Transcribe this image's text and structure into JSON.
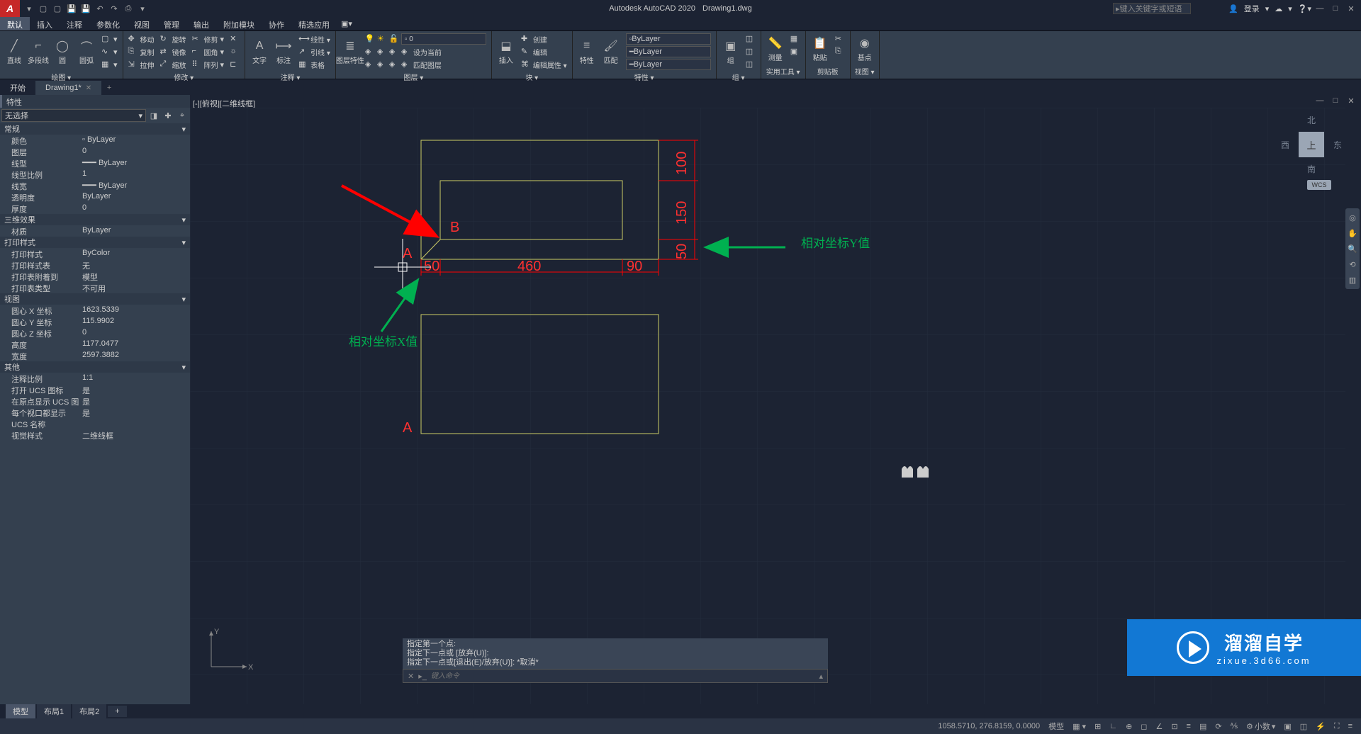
{
  "title": {
    "app": "Autodesk AutoCAD 2020",
    "doc": "Drawing1.dwg"
  },
  "search": {
    "placeholder": "键入关键字或短语"
  },
  "user": {
    "login": "登录"
  },
  "menu": {
    "tabs": [
      "默认",
      "插入",
      "注释",
      "参数化",
      "视图",
      "管理",
      "输出",
      "附加模块",
      "协作",
      "精选应用"
    ]
  },
  "ribbon": {
    "draw": {
      "label": "绘图 ▾",
      "line": "直线",
      "polyline": "多段线",
      "circle": "圆",
      "arc": "圆弧"
    },
    "modify": {
      "label": "修改 ▾",
      "move": "移动",
      "rotate": "旋转",
      "trim": "修剪",
      "copy": "复制",
      "mirror": "镜像",
      "fillet": "圆角",
      "stretch": "拉伸",
      "scale": "缩放",
      "array": "阵列"
    },
    "annotate": {
      "label": "注释 ▾",
      "text": "文字",
      "dim": "标注",
      "linear": "线性 ▾",
      "leader": "引线 ▾",
      "table": "表格"
    },
    "layers": {
      "label": "图层 ▾",
      "props": "图层特性",
      "current": "设为当前",
      "match": "匹配图层"
    },
    "block": {
      "label": "块 ▾",
      "insert": "插入",
      "create": "创建",
      "edit": "编辑",
      "attr": "编辑属性 ▾"
    },
    "props": {
      "label": "特性 ▾",
      "props": "特性",
      "match": "匹配",
      "bylayer": "ByLayer"
    },
    "group": {
      "label": "组 ▾",
      "group": "组"
    },
    "util": {
      "label": "实用工具 ▾",
      "measure": "测量"
    },
    "clip": {
      "label": "剪贴板",
      "paste": "粘贴"
    },
    "view": {
      "label": "视图 ▾",
      "base": "基点"
    }
  },
  "doctabs": {
    "start": "开始",
    "drawing": "Drawing1*"
  },
  "viewport": {
    "label": "[-][俯视][二维线框]"
  },
  "props_panel": {
    "title": "特性",
    "noselect": "无选择",
    "sections": {
      "general": "常规",
      "d3": "三维效果",
      "plot": "打印样式",
      "view": "视图",
      "misc": "其他"
    },
    "rows": {
      "color": {
        "k": "颜色",
        "v": "ByLayer"
      },
      "layer": {
        "k": "图层",
        "v": "0"
      },
      "linetype": {
        "k": "线型",
        "v": "ByLayer"
      },
      "ltscale": {
        "k": "线型比例",
        "v": "1"
      },
      "lineweight": {
        "k": "线宽",
        "v": "ByLayer"
      },
      "transparency": {
        "k": "透明度",
        "v": "ByLayer"
      },
      "thickness": {
        "k": "厚度",
        "v": "0"
      },
      "material": {
        "k": "材质",
        "v": "ByLayer"
      },
      "plotstyle": {
        "k": "打印样式",
        "v": "ByColor"
      },
      "plottable": {
        "k": "打印样式表",
        "v": "无"
      },
      "plotattach": {
        "k": "打印表附着到",
        "v": "模型"
      },
      "plottype": {
        "k": "打印表类型",
        "v": "不可用"
      },
      "centerx": {
        "k": "圆心 X 坐标",
        "v": "1623.5339"
      },
      "centery": {
        "k": "圆心 Y 坐标",
        "v": "115.9902"
      },
      "centerz": {
        "k": "圆心 Z 坐标",
        "v": "0"
      },
      "height": {
        "k": "高度",
        "v": "1177.0477"
      },
      "width": {
        "k": "宽度",
        "v": "2597.3882"
      },
      "annoscale": {
        "k": "注释比例",
        "v": "1:1"
      },
      "ucsicon": {
        "k": "打开 UCS 图标",
        "v": "是"
      },
      "ucsorigin": {
        "k": "在原点显示 UCS 图标",
        "v": "是"
      },
      "ucsvp": {
        "k": "每个视口都显示 UCS",
        "v": "是"
      },
      "ucsname": {
        "k": "UCS 名称",
        "v": ""
      },
      "vstyle": {
        "k": "视觉样式",
        "v": "二维线框"
      }
    }
  },
  "viewcube": {
    "face": "上",
    "n": "北",
    "s": "南",
    "e": "东",
    "w": "西",
    "wcs": "WCS"
  },
  "annotations": {
    "rel_x": "相对坐标X值",
    "rel_y": "相对坐标Y值",
    "A": "A",
    "B": "B",
    "dim50a": "50",
    "dim460": "460",
    "dim90": "90",
    "dim50b": "50",
    "dim150": "150",
    "dim100": "100"
  },
  "cmdline": {
    "hist1": "指定第一个点:",
    "hist2": "指定下一点或 [放弃(U)]:",
    "hist3": "指定下一点或[退出(E)/放弃(U)]: *取消*",
    "placeholder": "键入命令"
  },
  "modeltabs": {
    "model": "模型",
    "layout1": "布局1",
    "layout2": "布局2"
  },
  "status": {
    "coords": "1058.5710, 276.8159, 0.0000",
    "mode": "模型",
    "dec": "小数"
  },
  "watermark": {
    "main": "溜溜自学",
    "sub": "zixue.3d66.com"
  },
  "ucs": {
    "x": "X",
    "y": "Y"
  }
}
